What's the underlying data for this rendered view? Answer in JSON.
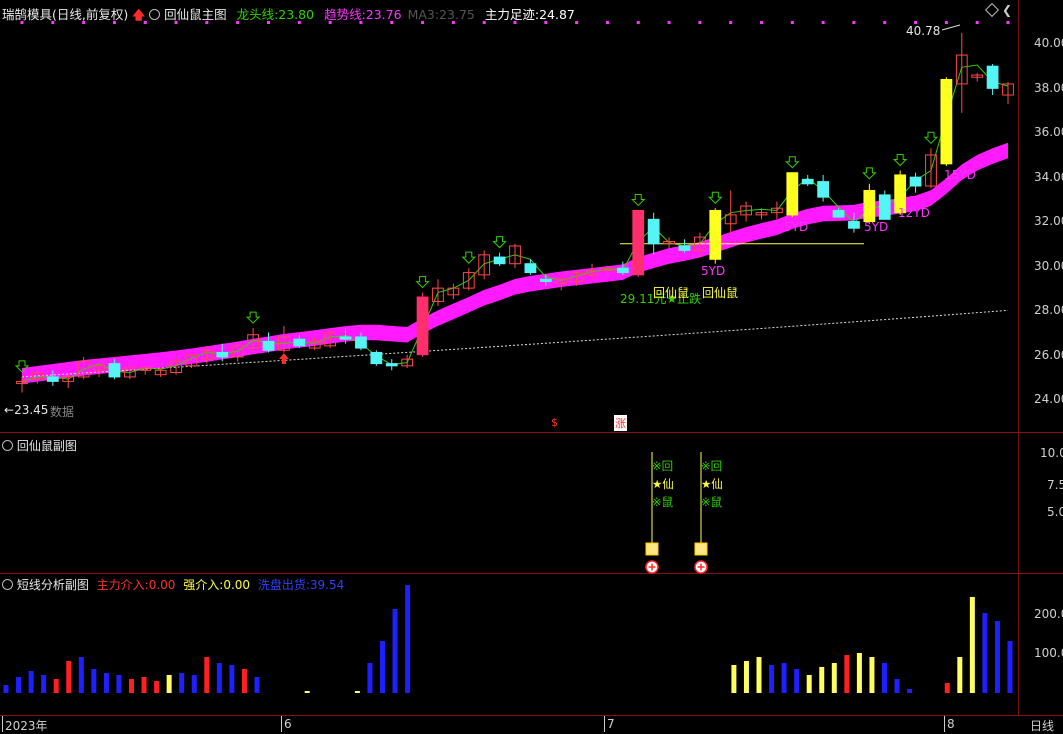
{
  "main_panel": {
    "stock_name": "瑞鹄模具",
    "period": "(日线,前复权)",
    "indicator_name": "回仙鼠主图",
    "lines": [
      {
        "label": "龙头线:",
        "value": "23.80",
        "color": "#31d000"
      },
      {
        "label": "趋势线:",
        "value": "23.76",
        "color": "#ff33ff"
      },
      {
        "label": "MA3:",
        "value": "23.75",
        "color": "#555555"
      },
      {
        "label": "主力足迹:",
        "value": "24.87",
        "color": "#ffffff"
      }
    ],
    "high_label": "40.78",
    "low_label": "23.45",
    "left_note": "数据",
    "y_ticks": [
      "40.00",
      "38.00",
      "36.00",
      "34.00",
      "32.00",
      "30.00",
      "28.00",
      "26.00",
      "24.00"
    ],
    "support_label": "29.11元★止跌",
    "rat_labels": [
      "回仙鼠",
      "回仙鼠"
    ],
    "yd_labels": [
      "5YD",
      "5YD",
      "5YD",
      "12YD",
      "15YD"
    ],
    "bottom_marks": [
      "$",
      "涨"
    ]
  },
  "sub1": {
    "title": "回仙鼠副图",
    "y_ticks": [
      "10.00",
      "7.50",
      "5.00"
    ],
    "signal_chars": [
      "※回",
      "★仙",
      "※鼠"
    ]
  },
  "sub2": {
    "title": "短线分析副图",
    "items": [
      {
        "label": "主力介入:",
        "value": "0.00",
        "color": "#ff3030"
      },
      {
        "label": "强介入:",
        "value": "0.00",
        "color": "#ffff40"
      },
      {
        "label": "洗盘出货:",
        "value": "39.54",
        "color": "#2020ff"
      }
    ],
    "y_ticks": [
      "200.00",
      "100.00"
    ]
  },
  "x_axis": {
    "labels": [
      "2023年",
      "6",
      "7",
      "8"
    ],
    "period_tab": "日线"
  },
  "chart_data": {
    "type": "candlestick",
    "candles": [
      [
        24.6,
        24.9,
        24.2,
        24.7
      ],
      [
        24.8,
        25.3,
        24.6,
        25.1
      ],
      [
        24.9,
        25.2,
        24.5,
        24.7
      ],
      [
        24.7,
        25.0,
        24.4,
        24.9
      ],
      [
        24.9,
        25.8,
        24.8,
        25.6
      ],
      [
        25.2,
        25.6,
        24.9,
        25.4
      ],
      [
        25.5,
        25.7,
        24.8,
        24.9
      ],
      [
        24.9,
        25.5,
        24.8,
        25.3
      ],
      [
        25.2,
        25.4,
        25.0,
        25.3
      ],
      [
        25.0,
        25.3,
        24.9,
        25.2
      ],
      [
        25.1,
        25.8,
        25.0,
        25.6
      ],
      [
        25.4,
        26.0,
        25.3,
        25.9
      ],
      [
        25.7,
        26.3,
        25.5,
        26.1
      ],
      [
        26.0,
        26.4,
        25.6,
        25.8
      ],
      [
        25.8,
        26.5,
        25.6,
        26.3
      ],
      [
        26.2,
        27.1,
        26.0,
        26.8
      ],
      [
        26.5,
        26.9,
        26.0,
        26.1
      ],
      [
        26.1,
        27.2,
        26.0,
        26.7
      ],
      [
        26.6,
        26.8,
        26.2,
        26.3
      ],
      [
        26.2,
        26.7,
        26.1,
        26.5
      ],
      [
        26.3,
        27.0,
        26.2,
        26.9
      ],
      [
        26.7,
        27.1,
        26.4,
        26.6
      ],
      [
        26.7,
        26.9,
        26.1,
        26.2
      ],
      [
        26.0,
        26.1,
        25.4,
        25.5
      ],
      [
        25.5,
        25.7,
        25.2,
        25.4
      ],
      [
        25.4,
        25.9,
        25.3,
        25.7
      ],
      [
        25.9,
        28.7,
        25.8,
        28.5
      ],
      [
        28.3,
        29.3,
        28.1,
        28.9
      ],
      [
        28.6,
        29.1,
        28.4,
        28.9
      ],
      [
        28.9,
        29.8,
        28.8,
        29.6
      ],
      [
        29.5,
        30.6,
        29.3,
        30.4
      ],
      [
        30.3,
        30.5,
        29.9,
        30.0
      ],
      [
        30.0,
        30.9,
        29.8,
        30.8
      ],
      [
        30.0,
        30.2,
        29.5,
        29.6
      ],
      [
        29.3,
        29.5,
        29.0,
        29.2
      ],
      [
        29.1,
        29.4,
        28.8,
        29.3
      ],
      [
        29.2,
        29.7,
        29.0,
        29.6
      ],
      [
        29.5,
        30.0,
        29.3,
        29.7
      ],
      [
        29.7,
        29.9,
        29.5,
        29.8
      ],
      [
        29.8,
        30.1,
        29.5,
        29.6
      ],
      [
        29.5,
        32.4,
        29.4,
        32.4
      ],
      [
        32.0,
        32.3,
        30.4,
        30.9
      ],
      [
        30.9,
        31.2,
        30.7,
        31.0
      ],
      [
        30.8,
        31.1,
        30.5,
        30.6
      ],
      [
        30.6,
        31.4,
        30.3,
        31.2
      ],
      [
        30.2,
        32.5,
        30.0,
        32.4
      ],
      [
        31.8,
        33.3,
        31.4,
        32.2
      ],
      [
        32.2,
        32.8,
        31.9,
        32.6
      ],
      [
        32.2,
        32.5,
        32.0,
        32.3
      ],
      [
        32.3,
        32.8,
        32.0,
        32.5
      ],
      [
        32.2,
        34.1,
        32.1,
        34.1
      ],
      [
        33.8,
        34.0,
        33.5,
        33.6
      ],
      [
        33.7,
        34.0,
        32.8,
        33.0
      ],
      [
        32.4,
        32.5,
        32.1,
        32.1
      ],
      [
        31.9,
        32.3,
        31.4,
        31.6
      ],
      [
        31.9,
        33.6,
        31.8,
        33.3
      ],
      [
        33.1,
        33.3,
        32.0,
        32.0
      ],
      [
        32.3,
        34.2,
        32.2,
        34.0
      ],
      [
        33.9,
        34.1,
        33.2,
        33.5
      ],
      [
        33.5,
        35.2,
        33.4,
        34.9
      ],
      [
        34.5,
        38.4,
        34.4,
        38.3
      ],
      [
        38.1,
        40.4,
        36.8,
        39.4
      ],
      [
        38.4,
        38.6,
        38.2,
        38.5
      ],
      [
        38.9,
        39.0,
        37.6,
        37.9
      ],
      [
        37.6,
        38.2,
        37.2,
        38.1
      ]
    ],
    "trend_band": [
      24.95,
      25.04,
      25.13,
      25.22,
      25.31,
      25.38,
      25.45,
      25.52,
      25.59,
      25.66,
      25.74,
      25.83,
      25.93,
      26.04,
      26.14,
      26.27,
      26.37,
      26.49,
      26.57,
      26.65,
      26.75,
      26.84,
      26.9,
      26.9,
      26.85,
      26.8,
      27.2,
      27.55,
      27.85,
      28.15,
      28.47,
      28.7,
      28.96,
      29.1,
      29.2,
      29.3,
      29.38,
      29.46,
      29.54,
      29.62,
      29.95,
      30.15,
      30.35,
      30.48,
      30.63,
      30.85,
      31.08,
      31.3,
      31.48,
      31.64,
      31.92,
      32.12,
      32.26,
      32.28,
      32.3,
      32.44,
      32.5,
      32.62,
      32.72,
      32.96,
      33.5,
      34.12,
      34.55,
      34.85,
      35.1
    ],
    "xlabels": [
      "2023年",
      "6",
      "7",
      "8"
    ],
    "y_range": [
      23.5,
      40.8
    ],
    "sub2_values": [
      20,
      40,
      55,
      45,
      35,
      80,
      90,
      60,
      50,
      45,
      35,
      40,
      30,
      45,
      50,
      45,
      90,
      75,
      70,
      60,
      40,
      30,
      20,
      30,
      5,
      0,
      0,
      0,
      5,
      75,
      130,
      210,
      270,
      220,
      190,
      120,
      50,
      0,
      0,
      0,
      0,
      0,
      0,
      0,
      0,
      0,
      0,
      0,
      0,
      0,
      0,
      0,
      0,
      0,
      0,
      0,
      0,
      0,
      70,
      80,
      90,
      70,
      75,
      60,
      45,
      65,
      75,
      95,
      100,
      90,
      75,
      35,
      10,
      0,
      0,
      25,
      90,
      240,
      200,
      180,
      130
    ],
    "sub2_colors": [
      "b",
      "b",
      "b",
      "b",
      "r",
      "r",
      "b",
      "b",
      "b",
      "b",
      "r",
      "r",
      "r",
      "y",
      "b",
      "b",
      "r",
      "b",
      "b",
      "r",
      "b",
      "x",
      "x",
      "x",
      "y",
      "y",
      "r",
      "y",
      "y",
      "b",
      "b",
      "b",
      "b",
      "x",
      "x",
      "x",
      "x",
      "x",
      "x",
      "x",
      "x",
      "x",
      "x",
      "x",
      "x",
      "x",
      "x",
      "x",
      "x",
      "x",
      "x",
      "x",
      "x",
      "x",
      "x",
      "x",
      "x",
      "x",
      "y",
      "y",
      "y",
      "b",
      "b",
      "b",
      "y",
      "y",
      "y",
      "r",
      "y",
      "y",
      "b",
      "b",
      "b",
      "x",
      "x",
      "r",
      "y",
      "y",
      "b",
      "b",
      "b"
    ]
  }
}
